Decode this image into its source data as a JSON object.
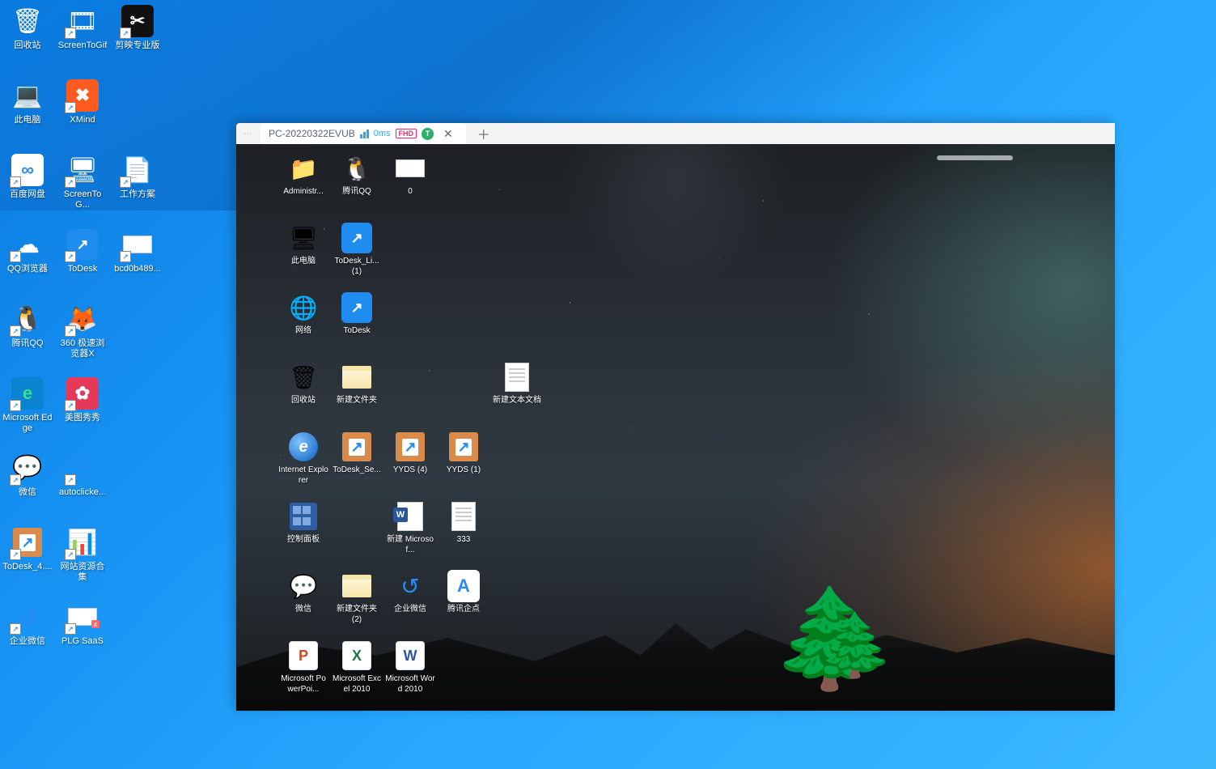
{
  "local_icons": [
    [
      {
        "id": "recycle-bin",
        "label": "回收站",
        "glyph": "🗑",
        "shortcut": false
      },
      {
        "id": "screentogif1",
        "label": "ScreenToGif",
        "glyph": "🎞",
        "shortcut": true
      },
      {
        "id": "jianying",
        "label": "剪映专业版",
        "glyph": "✂",
        "box": "#111",
        "shortcut": true
      }
    ],
    [
      {
        "id": "this-pc",
        "label": "此电脑",
        "glyph": "💻",
        "shortcut": false
      },
      {
        "id": "xmind",
        "label": "XMind",
        "glyph": "✖",
        "box": "#ff5a1f",
        "shortcut": true
      },
      null
    ],
    [
      {
        "id": "baidu-netdisk",
        "label": "百度网盘",
        "glyph": "∞",
        "box": "#fff",
        "fg": "#2b8af5",
        "shortcut": true
      },
      {
        "id": "screentogif2",
        "label": "ScreenToG...",
        "glyph": "🖥",
        "shortcut": true
      },
      {
        "id": "work-plan",
        "label": "工作方案",
        "glyph": "📄",
        "shortcut": true
      }
    ],
    [
      {
        "id": "qq-browser",
        "label": "QQ浏览器",
        "glyph": "☁",
        "fg": "#fff",
        "shortcut": true
      },
      {
        "id": "todesk-local",
        "label": "ToDesk",
        "kind": "todesk",
        "shortcut": true
      },
      {
        "id": "bcd0b",
        "label": "bcd0b489...",
        "kind": "whitebox",
        "shortcut": true
      }
    ],
    [
      {
        "id": "tencent-qq",
        "label": "腾讯QQ",
        "glyph": "🐧",
        "shortcut": true
      },
      {
        "id": "360-browser",
        "label": "360 极速浏览器X",
        "glyph": "🦊",
        "shortcut": true
      },
      null
    ],
    [
      {
        "id": "edge",
        "label": "Microsoft Edge",
        "glyph": "e",
        "box": "#0a84d0",
        "fg": "#39e08b",
        "shortcut": true
      },
      {
        "id": "meitu",
        "label": "美图秀秀",
        "glyph": "✿",
        "box": "#e6395a",
        "shortcut": true
      },
      null
    ],
    [
      {
        "id": "wechat",
        "label": "微信",
        "glyph": "💬",
        "fg": "#55c35a",
        "shortcut": true
      },
      {
        "id": "autoclicker",
        "label": "autoclicke...",
        "glyph": "🖱",
        "fg": "#2b8af5",
        "shortcut": true
      },
      null
    ],
    [
      {
        "id": "todesk-setup",
        "label": "ToDesk_4....",
        "kind": "setup-box",
        "shortcut": true
      },
      {
        "id": "web-res",
        "label": "网站资源合集",
        "glyph": "📊",
        "fg": "#2a8a3a",
        "shortcut": true
      },
      null
    ],
    [
      {
        "id": "ent-wechat",
        "label": "企业微信",
        "glyph": "↺",
        "fg": "#2b8af5",
        "shortcut": true
      },
      {
        "id": "plg-saas",
        "label": "PLG SaaS",
        "kind": "whitebox",
        "tag": "x",
        "shortcut": true
      },
      null
    ]
  ],
  "remote": {
    "tab_title": "PC-20220322EVUB",
    "latency": "0ms",
    "fhd_label": "FHD",
    "badge_letter": "T",
    "icons": [
      [
        {
          "id": "r-admin",
          "label": "Administr...",
          "glyph": "📁"
        },
        {
          "id": "r-qq",
          "label": "腾讯QQ",
          "glyph": "🐧"
        },
        {
          "id": "r-zero",
          "label": "0",
          "kind": "whitebox"
        }
      ],
      [
        {
          "id": "r-this-pc",
          "label": "此电脑",
          "glyph": "🖥"
        },
        {
          "id": "r-todesk-lite",
          "label": "ToDesk_Li... (1)",
          "kind": "todesk"
        }
      ],
      [
        {
          "id": "r-network",
          "label": "网络",
          "glyph": "🌐"
        },
        {
          "id": "r-todesk",
          "label": "ToDesk",
          "kind": "todesk"
        }
      ],
      [
        {
          "id": "r-recycle",
          "label": "回收站",
          "glyph": "🗑"
        },
        {
          "id": "r-newfolder",
          "label": "新建文件夹",
          "kind": "folder"
        },
        null,
        null,
        {
          "id": "r-newtxt",
          "label": "新建文本文档",
          "kind": "txtfile"
        }
      ],
      [
        {
          "id": "r-ie",
          "label": "Internet Explorer",
          "kind": "ie"
        },
        {
          "id": "r-todesk-se",
          "label": "ToDesk_Se...",
          "kind": "setup-box"
        },
        {
          "id": "r-yyds4",
          "label": "YYDS (4)",
          "kind": "setup-box"
        },
        {
          "id": "r-yyds1",
          "label": "YYDS (1)",
          "kind": "setup-box"
        }
      ],
      [
        {
          "id": "r-cp",
          "label": "控制面板",
          "kind": "cp"
        },
        null,
        {
          "id": "r-newword",
          "label": "新建 Microsof...",
          "kind": "wordfile"
        },
        {
          "id": "r-333",
          "label": "333",
          "kind": "txtfile"
        }
      ],
      [
        {
          "id": "r-wechat",
          "label": "微信",
          "glyph": "💬",
          "fg": "#55c35a"
        },
        {
          "id": "r-newfolder2",
          "label": "新建文件夹(2)",
          "kind": "folder"
        },
        {
          "id": "r-ent-wechat",
          "label": "企业微信",
          "glyph": "↺",
          "fg": "#2b8af5"
        },
        {
          "id": "r-tencent-qd",
          "label": "腾讯企点",
          "glyph": "A",
          "box": "#fff",
          "fg": "#2b8af5"
        }
      ],
      [
        {
          "id": "r-ppt",
          "label": "Microsoft PowerPoi...",
          "kind": "office",
          "letter": "P",
          "color": "#d24726"
        },
        {
          "id": "r-excel",
          "label": "Microsoft Excel 2010",
          "kind": "office",
          "letter": "X",
          "color": "#217346"
        },
        {
          "id": "r-word",
          "label": "Microsoft Word 2010",
          "kind": "office",
          "letter": "W",
          "color": "#2b579a"
        }
      ]
    ]
  }
}
